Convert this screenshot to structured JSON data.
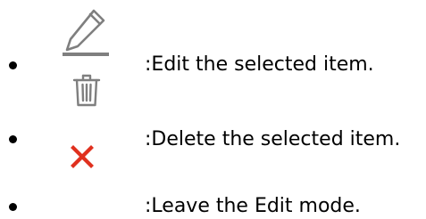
{
  "legend": {
    "items": [
      {
        "icon": "pencil-icon",
        "text": ":Edit the selected item."
      },
      {
        "icon": "trash-icon",
        "text": ":Delete the selected item."
      },
      {
        "icon": "close-x-icon",
        "text": ":Leave the Edit mode."
      }
    ]
  },
  "colors": {
    "text": "#000000",
    "icon_gray": "#7f7f7f",
    "close_red": "#e0301e"
  }
}
